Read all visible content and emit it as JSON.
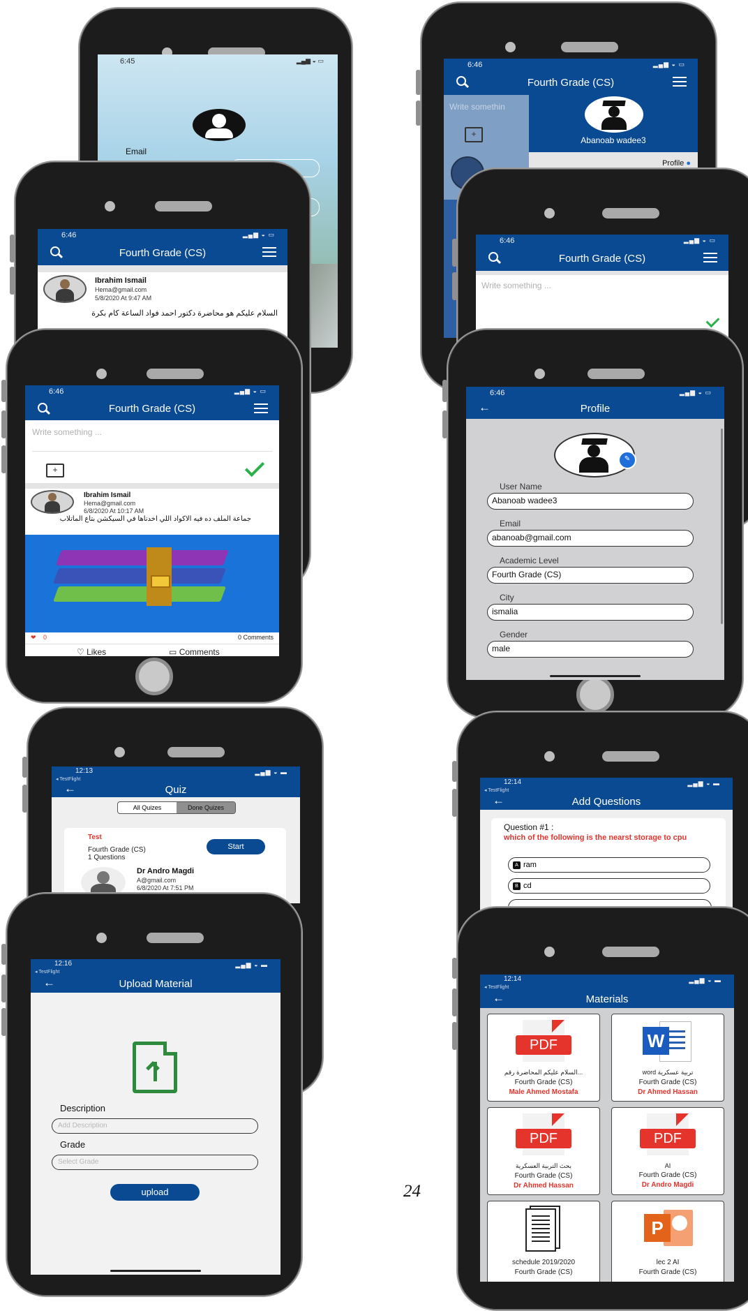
{
  "login": {
    "time": "6:45",
    "email_label": "Email"
  },
  "drawer": {
    "time": "6:46",
    "title": "Fourth Grade (CS)",
    "write_placeholder": "Write somethin",
    "user_name": "Abanoab wadee3",
    "profile_label": "Profile"
  },
  "feed_top": {
    "time": "6:46",
    "title": "Fourth Grade (CS)",
    "post": {
      "name": "Ibrahim Ismail",
      "email": "Hema@gmail.com",
      "date": "5/8/2020  At 9:47 AM",
      "text": "السلام عليكم هو محاضرة دكتور احمد فواد الساعة كام بكرة"
    }
  },
  "write_top": {
    "time": "6:46",
    "title": "Fourth Grade (CS)",
    "write_placeholder": "Write something ..."
  },
  "feed_main": {
    "time": "6:46",
    "title": "Fourth Grade (CS)",
    "write_placeholder": "Write something ...",
    "post": {
      "name": "Ibrahim Ismail",
      "email": "Hema@gmail.com",
      "date": "6/8/2020  At 10:17 AM",
      "text": "جماعة الملف ده فيه الاكواد اللي اخدناها في السيكشن بتاع الماتلاب"
    },
    "likes_count": "0",
    "comments_count": "0 Comments",
    "likes_label": "Likes",
    "comments_label": "Comments"
  },
  "profile": {
    "time": "6:46",
    "title": "Profile",
    "fields": [
      {
        "label": "User Name",
        "value": "Abanoab wadee3"
      },
      {
        "label": "Email",
        "value": "abanoab@gmail.com"
      },
      {
        "label": "Academic Level",
        "value": "Fourth Grade (CS)"
      },
      {
        "label": "City",
        "value": "ismalia"
      },
      {
        "label": "Gender",
        "value": "male"
      }
    ]
  },
  "quiz": {
    "time": "12:13",
    "carrier": "◂ TestFlight",
    "title": "Quiz",
    "tabs": [
      "All Quizes",
      "Done Quizes"
    ],
    "item": {
      "name": "Test",
      "grade": "Fourth Grade (CS)",
      "count": "1 Questions",
      "start_label": "Start",
      "author": "Dr Andro Magdi",
      "email": "A@gmail.com",
      "date": "6/8/2020  At 7:51 PM"
    }
  },
  "questions": {
    "time": "12:14",
    "carrier": "◂ TestFlight",
    "title": "Add Questions",
    "qnum": "Question #1 :",
    "question": "which of the following is the nearst storage to cpu",
    "options": [
      {
        "letter": "A",
        "text": "ram"
      },
      {
        "letter": "B",
        "text": "cd"
      }
    ]
  },
  "upload": {
    "time": "12:16",
    "carrier": "◂ TestFlight",
    "title": "Upload Material",
    "description_label": "Description",
    "description_placeholder": "Add Description",
    "grade_label": "Grade",
    "grade_placeholder": "Select Grade",
    "upload_label": "upload"
  },
  "materials": {
    "time": "12:14",
    "carrier": "◂ TestFlight",
    "title": "Materials",
    "items": [
      {
        "icon": "pdf",
        "title": "السلام عليكم المحاضرة رقم...",
        "grade": "Fourth Grade (CS)",
        "author": "Male Ahmed Mostafa"
      },
      {
        "icon": "word",
        "title": "word تربية عسكرية",
        "grade": "Fourth Grade (CS)",
        "author": "Dr Ahmed Hassan"
      },
      {
        "icon": "pdf",
        "title": "بحث التربية العسكرية",
        "grade": "Fourth Grade (CS)",
        "author": "Dr Ahmed Hassan"
      },
      {
        "icon": "pdf",
        "title": "AI",
        "grade": "Fourth Grade (CS)",
        "author": "Dr Andro Magdi"
      },
      {
        "icon": "doc",
        "title": "schedule 2019/2020",
        "grade": "Fourth Grade (CS)",
        "author": ""
      },
      {
        "icon": "ppt",
        "title": "lec 2 AI",
        "grade": "Fourth Grade (CS)",
        "author": ""
      }
    ],
    "pdf_text": "PDF",
    "word_text": "W",
    "ppt_text": "P"
  },
  "page_number": "24",
  "colors": {
    "brand": "#0a4a93",
    "accent_red": "#e4342c",
    "check_green": "#2bb04a",
    "upload_green": "#2e8b3e"
  }
}
